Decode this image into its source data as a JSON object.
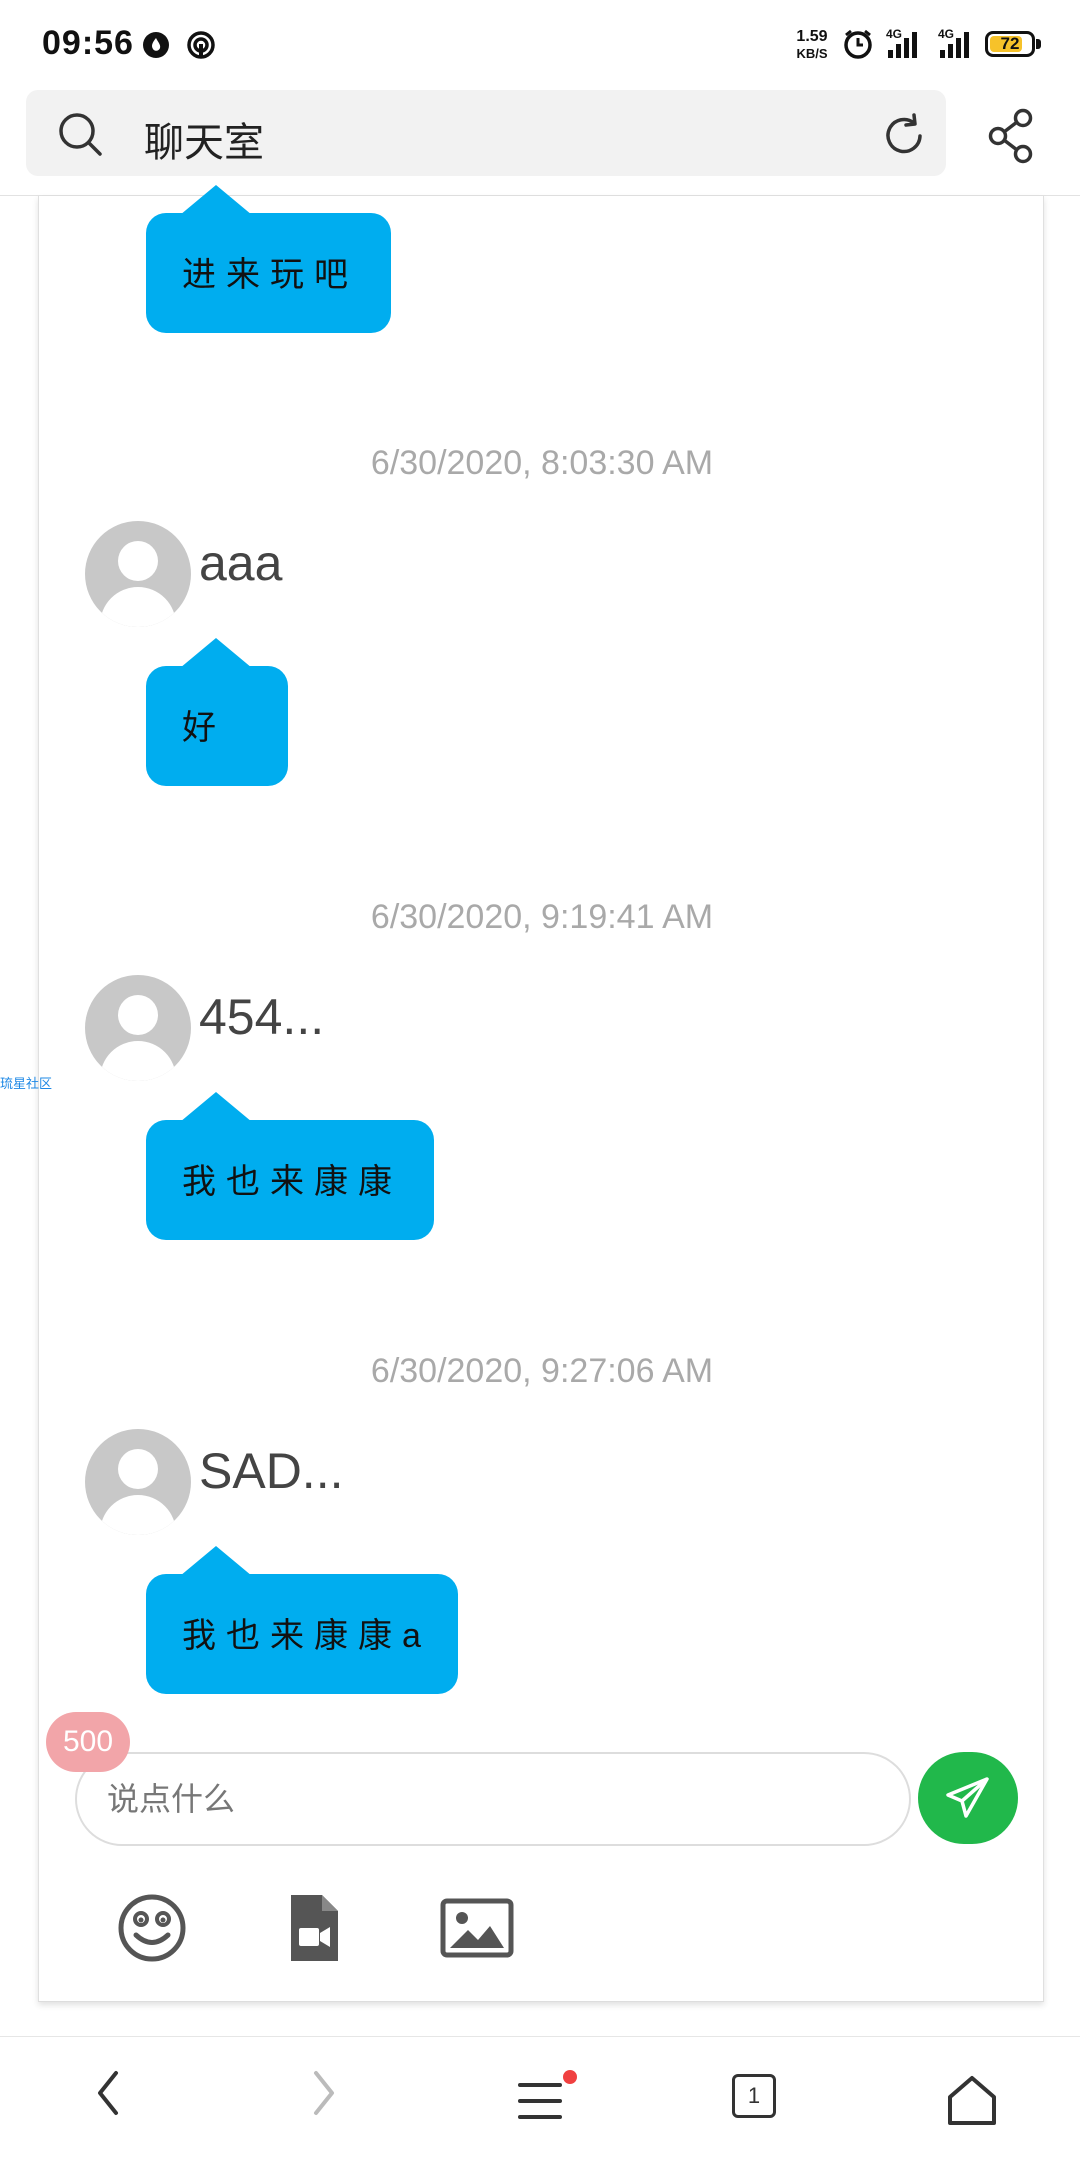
{
  "status_bar": {
    "time": "09:56",
    "net_speed_value": "1.59",
    "net_speed_unit": "KB/S",
    "network_1": "4G",
    "network_2": "4G",
    "battery": "72",
    "icons": [
      "app-notification-icon",
      "hotspot-icon",
      "alarm-icon",
      "signal-icon",
      "signal-icon",
      "battery-icon"
    ]
  },
  "header": {
    "title": "聊天室",
    "icons": [
      "search-icon",
      "refresh-icon",
      "share-icon"
    ]
  },
  "side_link": "琉星社区",
  "messages": [
    {
      "timestamp": "",
      "username": "",
      "text": "进来玩吧"
    },
    {
      "timestamp": "6/30/2020, 8:03:30 AM",
      "username": "aaa",
      "text": "好"
    },
    {
      "timestamp": "6/30/2020, 9:19:41 AM",
      "username": "454...",
      "text": "我也来康康"
    },
    {
      "timestamp": "6/30/2020, 9:27:06 AM",
      "username": "SAD...",
      "text": "我也来康康a"
    }
  ],
  "composer": {
    "remaining_count": "500",
    "placeholder": "说点什么",
    "tools": [
      "emoji-icon",
      "video-file-icon",
      "image-icon"
    ],
    "send_icon": "paper-plane-icon"
  },
  "bottom_nav": {
    "tab_count": "1",
    "icons": [
      "back-icon",
      "forward-icon",
      "menu-icon",
      "tabs-icon",
      "home-icon"
    ]
  },
  "colors": {
    "bubble": "#00adef",
    "send": "#21b84b",
    "badge": "#f2a5a9",
    "timestamp": "#a9a9a9"
  }
}
